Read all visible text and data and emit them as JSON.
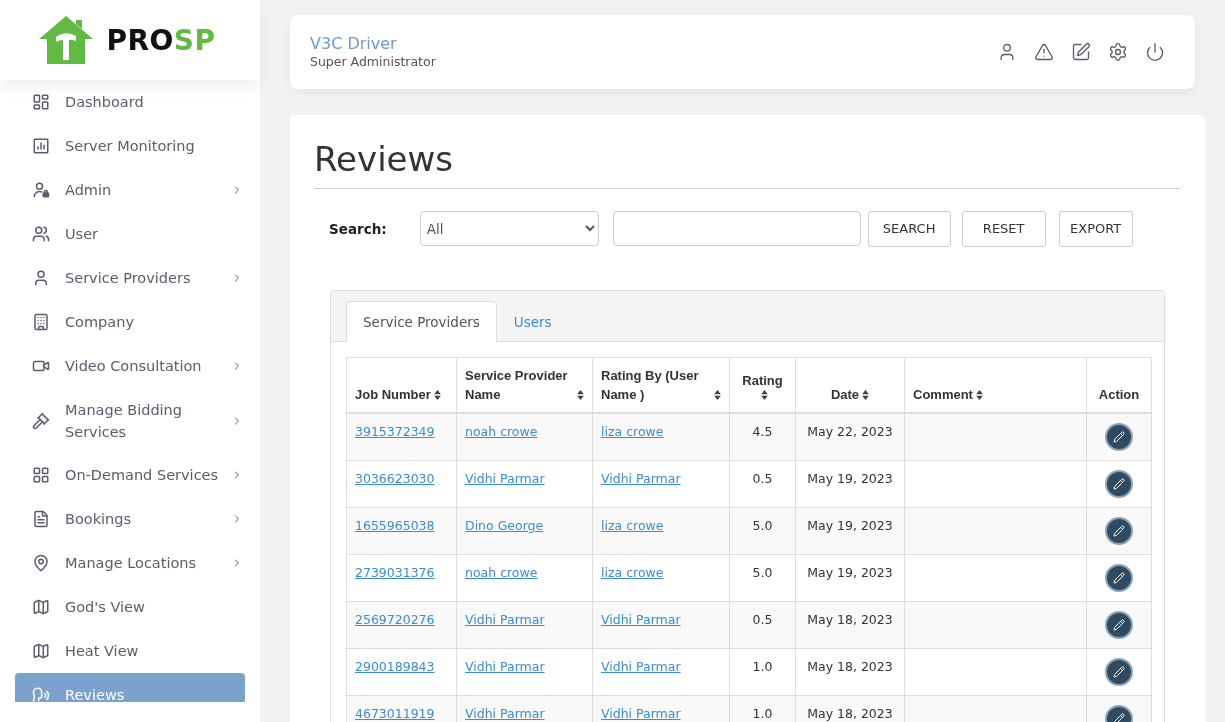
{
  "logo": {
    "parts": [
      {
        "text": "PRO",
        "color": "#111111"
      },
      {
        "text": "SP",
        "color": "#62b946"
      }
    ]
  },
  "sidebar": {
    "items": [
      {
        "label": "Dashboard",
        "has_submenu": false,
        "selected": false
      },
      {
        "label": "Server Monitoring",
        "has_submenu": false,
        "selected": false
      },
      {
        "label": "Admin",
        "has_submenu": true,
        "selected": false
      },
      {
        "label": "User",
        "has_submenu": false,
        "selected": false
      },
      {
        "label": "Service Providers",
        "has_submenu": true,
        "selected": false
      },
      {
        "label": "Company",
        "has_submenu": false,
        "selected": false
      },
      {
        "label": "Video Consultation",
        "has_submenu": true,
        "selected": false
      },
      {
        "label": "Manage Bidding Services",
        "has_submenu": true,
        "selected": false
      },
      {
        "label": "On-Demand Services",
        "has_submenu": true,
        "selected": false
      },
      {
        "label": "Bookings",
        "has_submenu": true,
        "selected": false
      },
      {
        "label": "Manage Locations",
        "has_submenu": true,
        "selected": false
      },
      {
        "label": "God's View",
        "has_submenu": false,
        "selected": false
      },
      {
        "label": "Heat View",
        "has_submenu": false,
        "selected": false
      },
      {
        "label": "Reviews",
        "has_submenu": false,
        "selected": true
      }
    ]
  },
  "header": {
    "user_name": "V3C Driver",
    "role": "Super Administrator"
  },
  "page": {
    "title": "Reviews"
  },
  "search": {
    "label": "Search:",
    "filter_value": "All",
    "buttons": [
      "SEARCH",
      "RESET",
      "EXPORT"
    ]
  },
  "tabs": [
    {
      "label": "Service Providers",
      "selected": true
    },
    {
      "label": "Users",
      "selected": false
    }
  ],
  "table": {
    "columns": [
      {
        "label": "Job Number",
        "sortable": true
      },
      {
        "label": "Service Provider Name",
        "sortable": true
      },
      {
        "label": "Rating By (User Name )",
        "sortable": true
      },
      {
        "label": "Rating",
        "sortable": true
      },
      {
        "label": "Date",
        "sortable": true
      },
      {
        "label": "Comment",
        "sortable": true
      },
      {
        "label": "Action",
        "sortable": false
      }
    ],
    "rows": [
      {
        "job_number": "3915372349",
        "provider": "noah crowe",
        "rated_by": "liza crowe",
        "rating": "4.5",
        "date": "May 22, 2023"
      },
      {
        "job_number": "3036623030",
        "provider": "Vidhi Parmar",
        "rated_by": "Vidhi Parmar",
        "rating": "0.5",
        "date": "May 19, 2023"
      },
      {
        "job_number": "1655965038",
        "provider": "Dino George",
        "rated_by": "liza crowe",
        "rating": "5.0",
        "date": "May 19, 2023"
      },
      {
        "job_number": "2739031376",
        "provider": "noah crowe",
        "rated_by": "liza crowe",
        "rating": "5.0",
        "date": "May 19, 2023"
      },
      {
        "job_number": "2569720276",
        "provider": "Vidhi Parmar",
        "rated_by": "Vidhi Parmar",
        "rating": "0.5",
        "date": "May 18, 2023"
      },
      {
        "job_number": "2900189843",
        "provider": "Vidhi Parmar",
        "rated_by": "Vidhi Parmar",
        "rating": "1.0",
        "date": "May 18, 2023"
      },
      {
        "job_number": "4673011919",
        "provider": "Vidhi Parmar",
        "rated_by": "Vidhi Parmar",
        "rating": "1.0",
        "date": "May 18, 2023"
      }
    ]
  }
}
